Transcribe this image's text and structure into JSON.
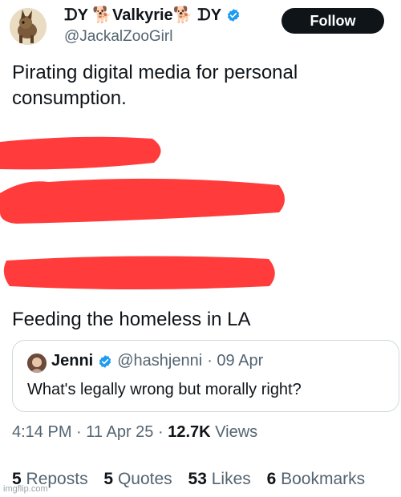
{
  "author": {
    "display_name": "ᗪY 🐕Valkyrie🐕 ᗪY",
    "handle": "@JackalZooGirl",
    "verified": true
  },
  "follow_label": "Follow",
  "post": {
    "text_1": "Pirating digital media for personal consumption.",
    "text_2": "Feeding the homeless in LA"
  },
  "quote": {
    "name": "Jenni",
    "handle": "@hashjenni",
    "date": "· 09 Apr",
    "text": "What's legally wrong but morally right?"
  },
  "meta": {
    "time": "4:14 PM",
    "date": "11 Apr 25",
    "sep": "·",
    "views_count": "12.7K",
    "views_label": "Views"
  },
  "stats": [
    {
      "count": "5",
      "label": "Reposts"
    },
    {
      "count": "5",
      "label": "Quotes"
    },
    {
      "count": "53",
      "label": "Likes"
    },
    {
      "count": "6",
      "label": "Bookmarks"
    }
  ],
  "colors": {
    "verified": "#1d9bf0",
    "redaction": "#ff3b3b"
  },
  "watermark": "imgflip.com"
}
